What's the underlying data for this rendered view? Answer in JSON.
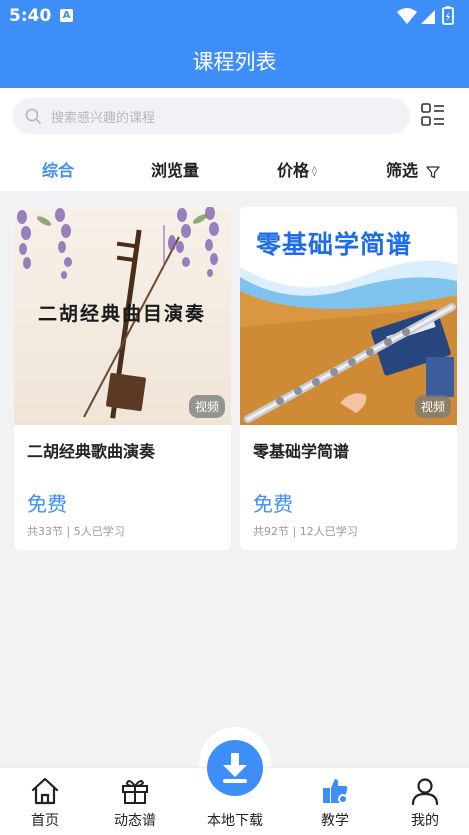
{
  "status_bar": {
    "time": "5:40",
    "notice_icon": "A"
  },
  "header": {
    "title": "课程列表"
  },
  "search": {
    "placeholder": "搜索感兴趣的课程"
  },
  "sort_tabs": [
    {
      "label": "综合",
      "active": true
    },
    {
      "label": "浏览量",
      "active": false
    },
    {
      "label": "价格",
      "active": false,
      "arrow": "◊"
    },
    {
      "label": "筛选",
      "active": false
    }
  ],
  "courses": [
    {
      "cover_text": "二胡经典曲目演奏",
      "badge": "视频",
      "title": "二胡经典歌曲演奏",
      "price": "免费",
      "meta": "共33节 | 5人已学习"
    },
    {
      "cover_text": "零基础学简谱",
      "badge": "视频",
      "title": "零基础学简谱",
      "price": "免费",
      "meta": "共92节 | 12人已学习"
    }
  ],
  "tabbar": {
    "items": [
      {
        "label": "首页",
        "icon": "home-icon"
      },
      {
        "label": "动态谱",
        "icon": "gift-icon"
      },
      {
        "label": "本地下载",
        "icon": "download-icon"
      },
      {
        "label": "教学",
        "icon": "teaching-icon",
        "active": true
      },
      {
        "label": "我的",
        "icon": "user-icon"
      }
    ]
  },
  "colors": {
    "accent": "#3d8ef7",
    "background": "#f2f2f4"
  }
}
